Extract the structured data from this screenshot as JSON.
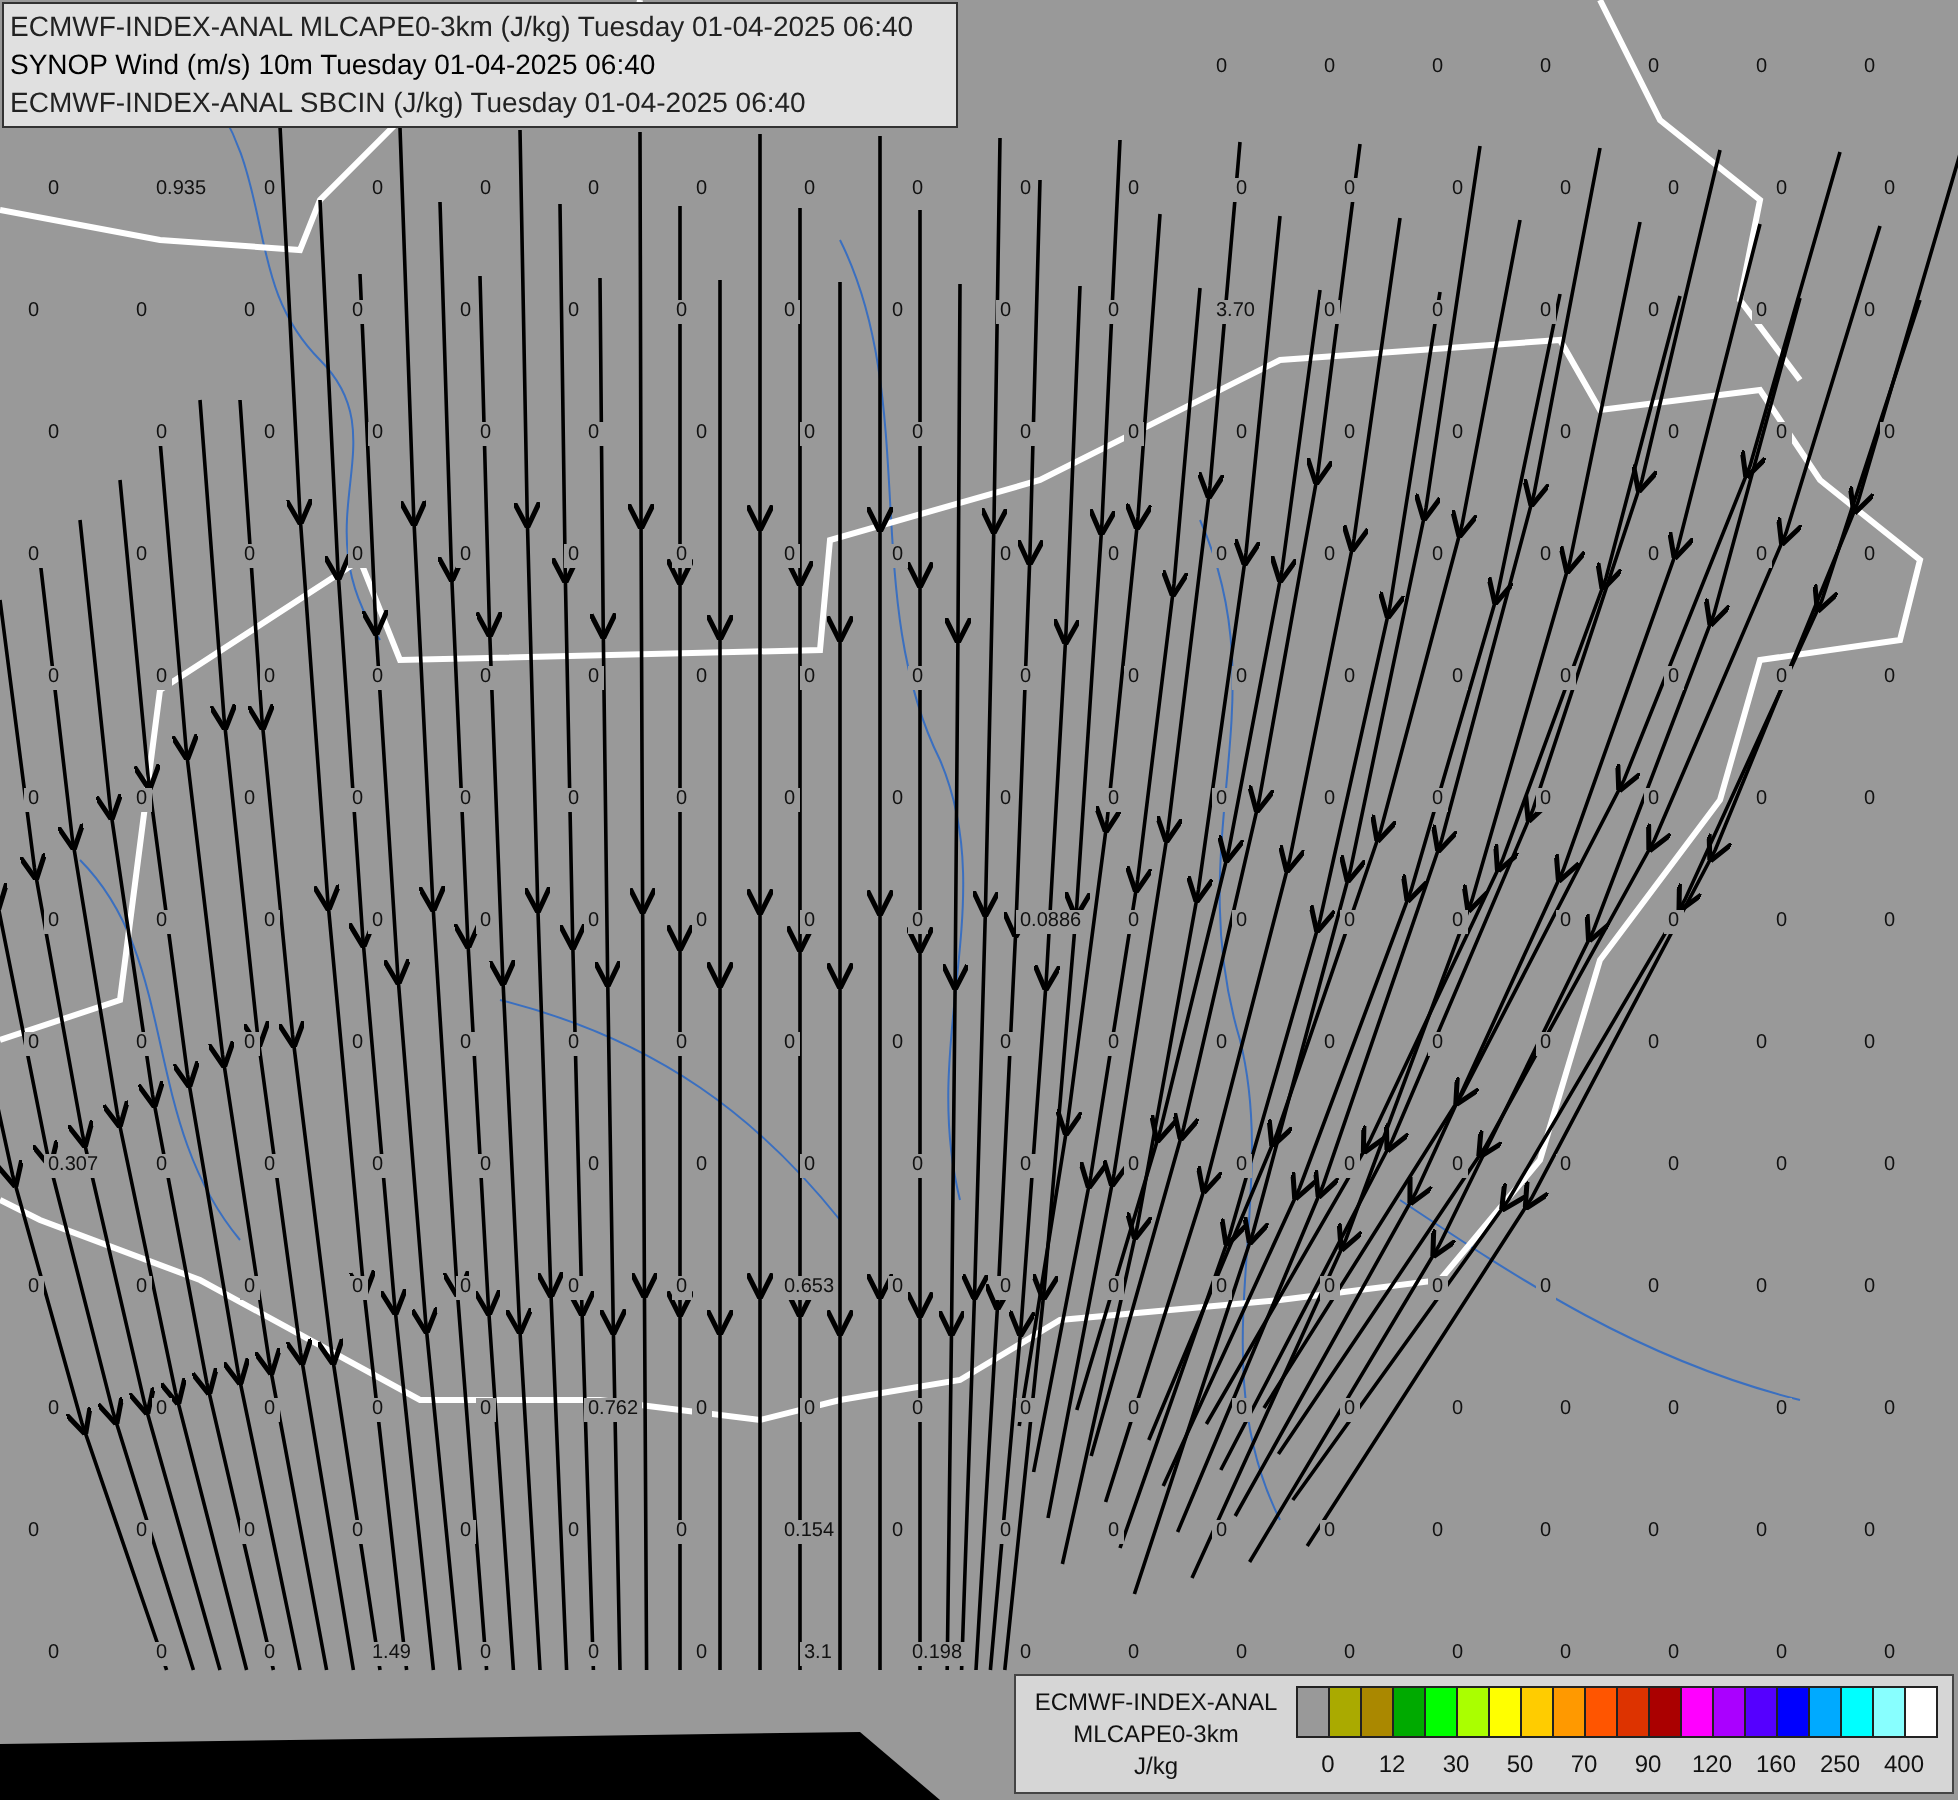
{
  "header": {
    "lines": [
      "ECMWF-INDEX-ANAL MLCAPE0-3km (J/kg) Tuesday 01-04-2025 06:40",
      "SYNOP Wind (m/s) 10m Tuesday 01-04-2025 06:40",
      "ECMWF-INDEX-ANAL SBCIN (J/kg) Tuesday 01-04-2025 06:40"
    ]
  },
  "station_values": [
    [
      "0",
      "0",
      "0",
      "0",
      "0",
      "0",
      "0"
    ],
    [
      "0",
      "0.935",
      "0",
      "0",
      "0",
      "0",
      "0",
      "0",
      "0",
      "0",
      "0",
      "0",
      "0",
      "0",
      "0",
      "0",
      "0",
      "0"
    ],
    [
      "0",
      "0",
      "0",
      "0",
      "0",
      "0",
      "0",
      "0",
      "0",
      "0",
      "0",
      "3.70",
      "0",
      "0",
      "0",
      "0",
      "0",
      "0"
    ],
    [
      "0",
      "0",
      "0",
      "0",
      "0",
      "0",
      "0",
      "0",
      "0",
      "0",
      "0",
      "0",
      "0",
      "0",
      "0",
      "0",
      "0",
      "0"
    ],
    [
      "0",
      "0",
      "0",
      "0",
      "0",
      "0",
      "0",
      "0",
      "0",
      "0",
      "0",
      "0",
      "0",
      "0",
      "0",
      "0",
      "0",
      "0"
    ],
    [
      "0",
      "0",
      "0",
      "0",
      "0",
      "0",
      "0",
      "0",
      "0",
      "0",
      "0",
      "0",
      "0",
      "0",
      "0",
      "0",
      "0",
      "0"
    ],
    [
      "0",
      "0",
      "0",
      "0",
      "0",
      "0",
      "0",
      "0",
      "0",
      "0",
      "0",
      "0",
      "0",
      "0",
      "0",
      "0",
      "0",
      "0"
    ],
    [
      "0",
      "0",
      "0",
      "0",
      "0",
      "0",
      "0",
      "0",
      "0",
      "0.0886",
      "0",
      "0",
      "0",
      "0",
      "0",
      "0",
      "0",
      "0"
    ],
    [
      "0",
      "0",
      "0",
      "0",
      "0",
      "0",
      "0",
      "0",
      "0",
      "0",
      "0",
      "0",
      "0",
      "0",
      "0",
      "0",
      "0",
      "0"
    ],
    [
      "0.307",
      "0",
      "0",
      "0",
      "0",
      "0",
      "0",
      "0",
      "0",
      "0",
      "0",
      "0",
      "0",
      "0",
      "0",
      "0",
      "0",
      "0"
    ],
    [
      "0",
      "0",
      "0",
      "0",
      "0",
      "0",
      "0",
      "0.653",
      "0",
      "0",
      "0",
      "0",
      "0",
      "0",
      "0",
      "0",
      "0",
      "0"
    ],
    [
      "0",
      "0",
      "0",
      "0",
      "0",
      "0.762",
      "0",
      "0",
      "0",
      "0",
      "0",
      "0",
      "0",
      "0",
      "0",
      "0",
      "0",
      "0"
    ],
    [
      "0",
      "0",
      "0",
      "0",
      "0",
      "0",
      "0",
      "0.154",
      "0",
      "0",
      "0",
      "0",
      "0",
      "0",
      "0",
      "0",
      "0",
      "0"
    ],
    [
      "0",
      "0",
      "0",
      "1.49",
      "0",
      "0",
      "0",
      "3.1",
      "0.198",
      "0",
      "0",
      "0",
      "0",
      "0",
      "0",
      "0",
      "0",
      "0"
    ]
  ],
  "legend": {
    "title_lines": [
      "ECMWF-INDEX-ANAL",
      "MLCAPE0-3km",
      "J/kg"
    ],
    "swatches": [
      {
        "color": "#999999"
      },
      {
        "color": "#aaaa00"
      },
      {
        "color": "#aa8800"
      },
      {
        "color": "#00aa00"
      },
      {
        "color": "#00ff00"
      },
      {
        "color": "#aaff00"
      },
      {
        "color": "#ffff00"
      },
      {
        "color": "#ffcc00"
      },
      {
        "color": "#ff9900"
      },
      {
        "color": "#ff5500"
      },
      {
        "color": "#dd3300"
      },
      {
        "color": "#aa0000"
      },
      {
        "color": "#ff00ff"
      },
      {
        "color": "#aa00ff"
      },
      {
        "color": "#5500ff"
      },
      {
        "color": "#0000ff"
      },
      {
        "color": "#00aaff"
      },
      {
        "color": "#00ffff"
      },
      {
        "color": "#88ffff"
      },
      {
        "color": "#ffffff"
      }
    ],
    "ticks": [
      "0",
      "12",
      "30",
      "50",
      "70",
      "90",
      "120",
      "160",
      "250",
      "400"
    ]
  }
}
